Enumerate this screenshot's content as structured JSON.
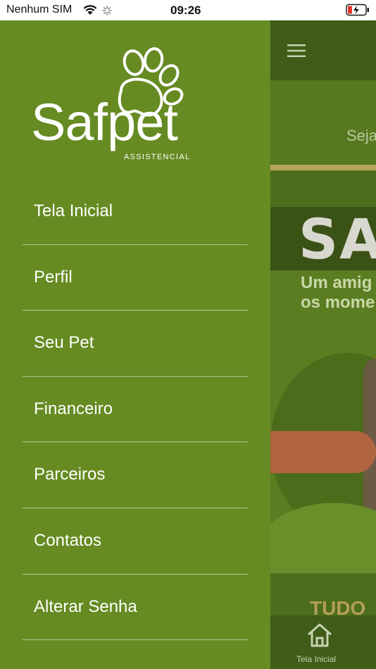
{
  "status_bar": {
    "carrier": "Nenhum SIM",
    "time": "09:26",
    "icons": [
      "wifi-icon",
      "activity-spinner-icon",
      "battery-charging-icon"
    ]
  },
  "drawer": {
    "logo": {
      "wordmark": "Safpet",
      "subtitle": "ASSISTENCIAL",
      "icon": "paw-icon"
    },
    "items": [
      {
        "label": "Tela Inicial"
      },
      {
        "label": "Perfil"
      },
      {
        "label": "Seu Pet"
      },
      {
        "label": "Financeiro"
      },
      {
        "label": "Parceiros"
      },
      {
        "label": "Contatos"
      },
      {
        "label": "Alterar Senha"
      }
    ],
    "background_color": "#668b22"
  },
  "background_screen": {
    "menu_icon": "hamburger-menu-icon",
    "welcome_text": "Seja",
    "banner_title": "SAF",
    "banner_subtitle_line1": "Um amig",
    "banner_subtitle_line2": "os mome",
    "bottom_text": "TUDO",
    "tab_bar": {
      "tabs": [
        {
          "label": "Tela Inicial",
          "icon": "home-icon"
        }
      ]
    }
  }
}
